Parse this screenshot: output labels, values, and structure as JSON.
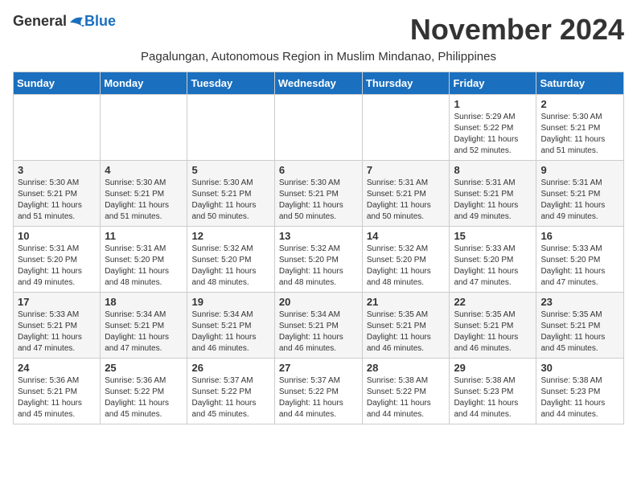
{
  "header": {
    "logo_general": "General",
    "logo_blue": "Blue",
    "month_title": "November 2024",
    "subtitle": "Pagalungan, Autonomous Region in Muslim Mindanao, Philippines"
  },
  "calendar": {
    "days_of_week": [
      "Sunday",
      "Monday",
      "Tuesday",
      "Wednesday",
      "Thursday",
      "Friday",
      "Saturday"
    ],
    "weeks": [
      [
        {
          "day": "",
          "info": ""
        },
        {
          "day": "",
          "info": ""
        },
        {
          "day": "",
          "info": ""
        },
        {
          "day": "",
          "info": ""
        },
        {
          "day": "",
          "info": ""
        },
        {
          "day": "1",
          "info": "Sunrise: 5:29 AM\nSunset: 5:22 PM\nDaylight: 11 hours and 52 minutes."
        },
        {
          "day": "2",
          "info": "Sunrise: 5:30 AM\nSunset: 5:21 PM\nDaylight: 11 hours and 51 minutes."
        }
      ],
      [
        {
          "day": "3",
          "info": "Sunrise: 5:30 AM\nSunset: 5:21 PM\nDaylight: 11 hours and 51 minutes."
        },
        {
          "day": "4",
          "info": "Sunrise: 5:30 AM\nSunset: 5:21 PM\nDaylight: 11 hours and 51 minutes."
        },
        {
          "day": "5",
          "info": "Sunrise: 5:30 AM\nSunset: 5:21 PM\nDaylight: 11 hours and 50 minutes."
        },
        {
          "day": "6",
          "info": "Sunrise: 5:30 AM\nSunset: 5:21 PM\nDaylight: 11 hours and 50 minutes."
        },
        {
          "day": "7",
          "info": "Sunrise: 5:31 AM\nSunset: 5:21 PM\nDaylight: 11 hours and 50 minutes."
        },
        {
          "day": "8",
          "info": "Sunrise: 5:31 AM\nSunset: 5:21 PM\nDaylight: 11 hours and 49 minutes."
        },
        {
          "day": "9",
          "info": "Sunrise: 5:31 AM\nSunset: 5:21 PM\nDaylight: 11 hours and 49 minutes."
        }
      ],
      [
        {
          "day": "10",
          "info": "Sunrise: 5:31 AM\nSunset: 5:20 PM\nDaylight: 11 hours and 49 minutes."
        },
        {
          "day": "11",
          "info": "Sunrise: 5:31 AM\nSunset: 5:20 PM\nDaylight: 11 hours and 48 minutes."
        },
        {
          "day": "12",
          "info": "Sunrise: 5:32 AM\nSunset: 5:20 PM\nDaylight: 11 hours and 48 minutes."
        },
        {
          "day": "13",
          "info": "Sunrise: 5:32 AM\nSunset: 5:20 PM\nDaylight: 11 hours and 48 minutes."
        },
        {
          "day": "14",
          "info": "Sunrise: 5:32 AM\nSunset: 5:20 PM\nDaylight: 11 hours and 48 minutes."
        },
        {
          "day": "15",
          "info": "Sunrise: 5:33 AM\nSunset: 5:20 PM\nDaylight: 11 hours and 47 minutes."
        },
        {
          "day": "16",
          "info": "Sunrise: 5:33 AM\nSunset: 5:20 PM\nDaylight: 11 hours and 47 minutes."
        }
      ],
      [
        {
          "day": "17",
          "info": "Sunrise: 5:33 AM\nSunset: 5:21 PM\nDaylight: 11 hours and 47 minutes."
        },
        {
          "day": "18",
          "info": "Sunrise: 5:34 AM\nSunset: 5:21 PM\nDaylight: 11 hours and 47 minutes."
        },
        {
          "day": "19",
          "info": "Sunrise: 5:34 AM\nSunset: 5:21 PM\nDaylight: 11 hours and 46 minutes."
        },
        {
          "day": "20",
          "info": "Sunrise: 5:34 AM\nSunset: 5:21 PM\nDaylight: 11 hours and 46 minutes."
        },
        {
          "day": "21",
          "info": "Sunrise: 5:35 AM\nSunset: 5:21 PM\nDaylight: 11 hours and 46 minutes."
        },
        {
          "day": "22",
          "info": "Sunrise: 5:35 AM\nSunset: 5:21 PM\nDaylight: 11 hours and 46 minutes."
        },
        {
          "day": "23",
          "info": "Sunrise: 5:35 AM\nSunset: 5:21 PM\nDaylight: 11 hours and 45 minutes."
        }
      ],
      [
        {
          "day": "24",
          "info": "Sunrise: 5:36 AM\nSunset: 5:21 PM\nDaylight: 11 hours and 45 minutes."
        },
        {
          "day": "25",
          "info": "Sunrise: 5:36 AM\nSunset: 5:22 PM\nDaylight: 11 hours and 45 minutes."
        },
        {
          "day": "26",
          "info": "Sunrise: 5:37 AM\nSunset: 5:22 PM\nDaylight: 11 hours and 45 minutes."
        },
        {
          "day": "27",
          "info": "Sunrise: 5:37 AM\nSunset: 5:22 PM\nDaylight: 11 hours and 44 minutes."
        },
        {
          "day": "28",
          "info": "Sunrise: 5:38 AM\nSunset: 5:22 PM\nDaylight: 11 hours and 44 minutes."
        },
        {
          "day": "29",
          "info": "Sunrise: 5:38 AM\nSunset: 5:23 PM\nDaylight: 11 hours and 44 minutes."
        },
        {
          "day": "30",
          "info": "Sunrise: 5:38 AM\nSunset: 5:23 PM\nDaylight: 11 hours and 44 minutes."
        }
      ]
    ]
  }
}
